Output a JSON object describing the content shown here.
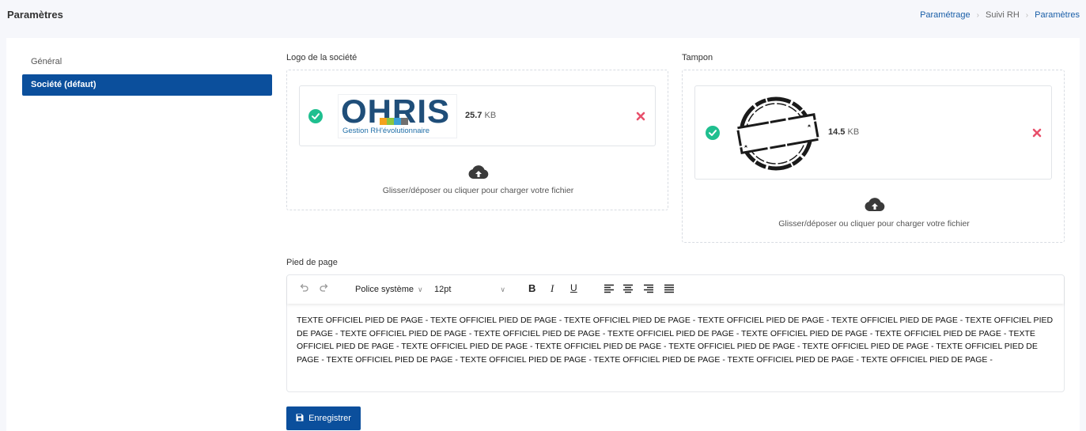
{
  "header": {
    "title": "Paramètres",
    "breadcrumb": [
      "Paramétrage",
      "Suivi RH",
      "Paramètres"
    ]
  },
  "nav": {
    "items": [
      {
        "label": "Général",
        "active": false
      },
      {
        "label": "Société (défaut)",
        "active": true
      }
    ]
  },
  "logo": {
    "label": "Logo de la société",
    "image_text": "OHRIS",
    "image_subtext": "Gestion RH'évolutionnaire",
    "size_value": "25.7",
    "size_unit": "KB",
    "upload_text": "Glisser/déposer ou cliquer pour charger votre fichier"
  },
  "stamp": {
    "label": "Tampon",
    "size_value": "14.5",
    "size_unit": "KB",
    "upload_text": "Glisser/déposer ou cliquer pour charger votre fichier"
  },
  "footer": {
    "label": "Pied de page",
    "font": "Police système",
    "font_size": "12pt",
    "content": "TEXTE OFFICIEL PIED DE PAGE - TEXTE OFFICIEL PIED DE PAGE - TEXTE OFFICIEL PIED DE PAGE - TEXTE OFFICIEL PIED DE PAGE - TEXTE OFFICIEL PIED DE PAGE - TEXTE OFFICIEL PIED DE PAGE - TEXTE OFFICIEL PIED DE PAGE - TEXTE OFFICIEL PIED DE PAGE - TEXTE OFFICIEL PIED DE PAGE - TEXTE OFFICIEL PIED DE PAGE - TEXTE OFFICIEL PIED DE PAGE - TEXTE OFFICIEL PIED DE PAGE - TEXTE OFFICIEL PIED DE PAGE - TEXTE OFFICIEL PIED DE PAGE - TEXTE OFFICIEL PIED DE PAGE - TEXTE OFFICIEL PIED DE PAGE - TEXTE OFFICIEL PIED DE PAGE - TEXTE OFFICIEL PIED DE PAGE - TEXTE OFFICIEL PIED DE PAGE - TEXTE OFFICIEL PIED DE PAGE - TEXTE OFFICIEL PIED DE PAGE - TEXTE OFFICIEL PIED DE PAGE -"
  },
  "actions": {
    "save_label": "Enregistrer"
  },
  "colors": {
    "primary": "#0b4f9c",
    "success": "#1fbf8f",
    "danger": "#e8506b",
    "logo_blue": "#1f4e79"
  },
  "icons": [
    "check-circle-icon",
    "close-icon",
    "cloud-upload-icon",
    "undo-icon",
    "redo-icon",
    "bold-icon",
    "italic-icon",
    "underline-icon",
    "align-left-icon",
    "align-center-icon",
    "align-right-icon",
    "align-justify-icon",
    "save-icon"
  ]
}
